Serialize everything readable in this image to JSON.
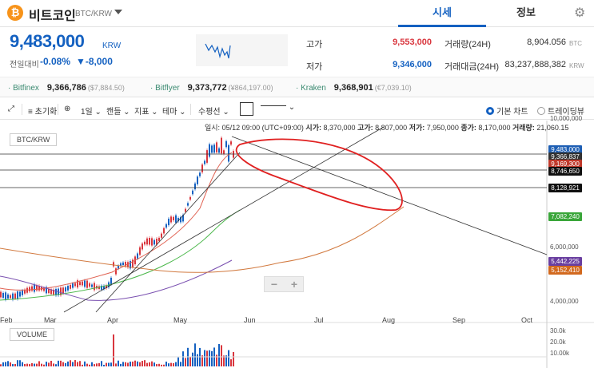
{
  "header": {
    "coin_name": "비트코인",
    "pair": "BTC/KRW",
    "tabs": [
      "시세",
      "정보"
    ]
  },
  "price": {
    "current": "9,483,000",
    "unit": "KRW",
    "change_label": "전일대비",
    "change_rate": "-0.08%",
    "change_amount": "▼-8,000"
  },
  "stats": {
    "high_label": "고가",
    "high": "9,553,000",
    "low_label": "저가",
    "low": "9,346,000",
    "volume_label": "거래량(24H)",
    "volume": "8,904.056",
    "volume_unit": "BTC",
    "amount_label": "거래대금(24H)",
    "amount": "83,237,888,382",
    "amount_unit": "KRW"
  },
  "exchanges": [
    {
      "name": "· Bitfinex",
      "krw": "9,366,786",
      "usd": "($7,884.50)"
    },
    {
      "name": "· Bitflyer",
      "krw": "9,373,772",
      "usd": "(¥864,197.00)"
    },
    {
      "name": "· Kraken",
      "krw": "9,368,901",
      "usd": "(€7,039.10)"
    }
  ],
  "toolbar": {
    "reset": "초기화",
    "interval": "1일",
    "candle": "캔들",
    "indicator": "지표",
    "theme": "테마",
    "hline": "수평선",
    "basic_chart": "기본 차트",
    "tradingview": "트레이딩뷰"
  },
  "ohlc": {
    "date_label": "일시:",
    "date": "05/12 09:00 (UTC+09:00)",
    "open_label": "시가:",
    "open": "8,370,000",
    "high_label": "고가:",
    "high": "8,807,000",
    "low_label": "저가:",
    "low": "7,950,000",
    "close_label": "종가:",
    "close": "8,170,000",
    "vol_label": "거래량:",
    "vol": "21,060.15"
  },
  "chart_data": {
    "type": "candlestick",
    "pair": "BTC/KRW",
    "x_months": [
      "Feb",
      "Mar",
      "Apr",
      "May",
      "Jun",
      "Jul",
      "Aug",
      "Sep",
      "Oct"
    ],
    "y_ticks": [
      "10,000,000",
      "8,000,000",
      "6,000,000",
      "4,000,000"
    ],
    "price_labels": [
      {
        "value": "9,483,000",
        "color": "#1e5fb4"
      },
      {
        "value": "9,366,837",
        "color": "#333333"
      },
      {
        "value": "9,169,300",
        "color": "#c0392b"
      },
      {
        "value": "8,746,650",
        "color": "#111111"
      },
      {
        "value": "8,128,921",
        "color": "#111111"
      },
      {
        "value": "7,082,240",
        "color": "#3aa63a"
      },
      {
        "value": "5,442,225",
        "color": "#6a3fa0"
      },
      {
        "value": "5,152,410",
        "color": "#d2691e"
      }
    ],
    "volume_ticks": [
      "30.0k",
      "20.0k",
      "10.00k"
    ],
    "volume_label": "VOLUME"
  }
}
